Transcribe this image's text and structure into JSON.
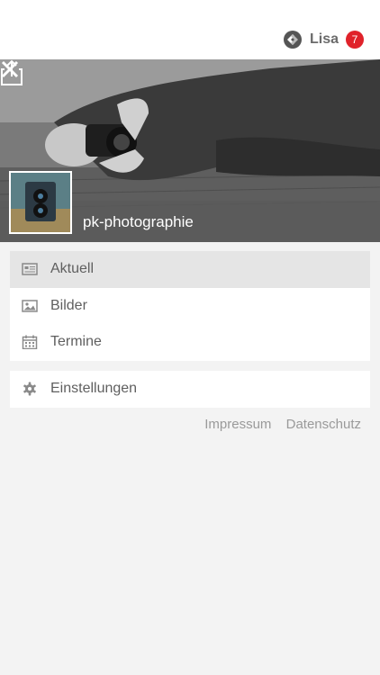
{
  "header": {
    "user_name": "Lisa",
    "notification_count": "7",
    "badge_color": "#e0222a",
    "logo_icon": "app-logo-icon"
  },
  "profile": {
    "page_name": "pk-photographie",
    "share_icon": "share-icon",
    "close_icon": "close-icon"
  },
  "menu": {
    "primary": [
      {
        "label": "Aktuell",
        "icon": "newspaper-icon",
        "active": true
      },
      {
        "label": "Bilder",
        "icon": "image-icon",
        "active": false
      },
      {
        "label": "Termine",
        "icon": "calendar-icon",
        "active": false
      }
    ],
    "secondary": [
      {
        "label": "Einstellungen",
        "icon": "gear-icon",
        "active": false
      }
    ]
  },
  "footer": {
    "impressum": "Impressum",
    "datenschutz": "Datenschutz"
  }
}
